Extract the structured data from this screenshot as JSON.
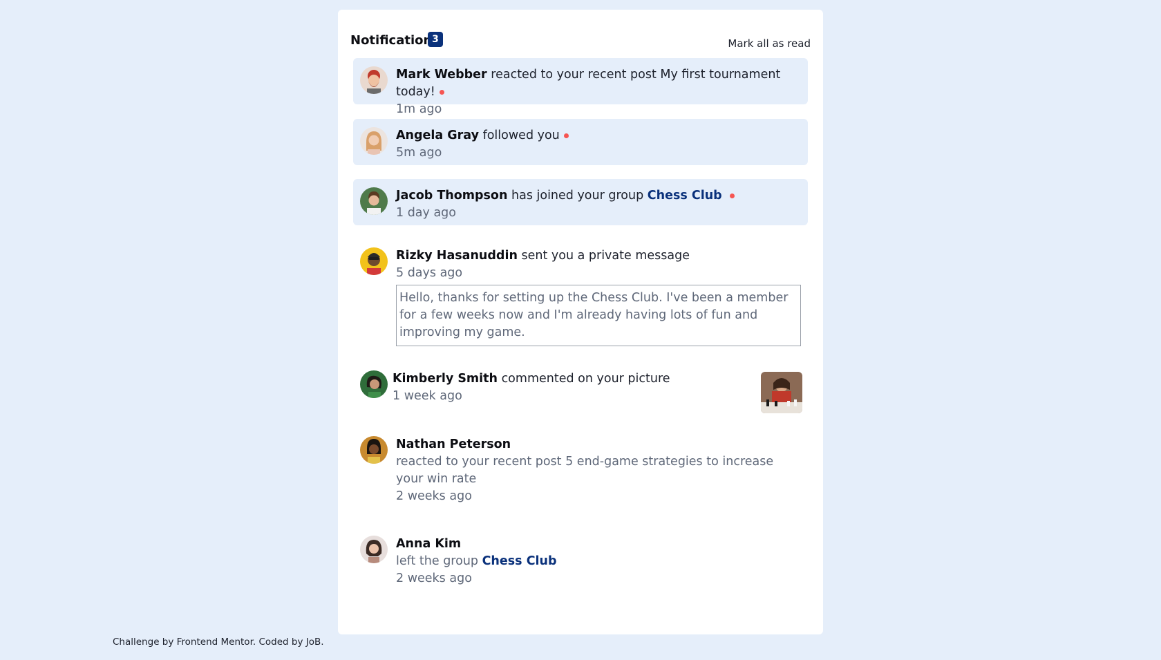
{
  "header": {
    "title": "Notifications",
    "badge": "3",
    "mark_all": "Mark all as read"
  },
  "notifications": [
    {
      "name": "Mark Webber",
      "action": "reacted to your recent post",
      "target": "My first tournament today!",
      "time": "1m ago",
      "unread": true,
      "avatar_icon": "avatar-mark-webber"
    },
    {
      "name": "Angela Gray",
      "action": "followed you",
      "time": "5m ago",
      "unread": true,
      "avatar_icon": "avatar-angela-gray"
    },
    {
      "name": "Jacob Thompson",
      "action": "has joined your group",
      "group": "Chess Club",
      "time": "1 day ago",
      "unread": true,
      "avatar_icon": "avatar-jacob-thompson"
    },
    {
      "name": "Rizky Hasanuddin",
      "action": "sent you a private message",
      "time": "5 days ago",
      "message": "Hello, thanks for setting up the Chess Club. I've been a member for a few weeks now and I'm already having lots of fun and improving my game.",
      "unread": false,
      "avatar_icon": "avatar-rizky-hasanuddin"
    },
    {
      "name": "Kimberly Smith",
      "action": "commented on your picture",
      "time": "1 week ago",
      "unread": false,
      "avatar_icon": "avatar-kimberly-smith",
      "picture_icon": "chess-picture-thumbnail"
    },
    {
      "name": "Nathan Peterson",
      "action": "reacted to your recent post 5 end-game strategies to increase your win rate",
      "time": "2 weeks ago",
      "unread": false,
      "avatar_icon": "avatar-nathan-peterson"
    },
    {
      "name": "Anna Kim",
      "action": "left the group",
      "group": "Chess Club",
      "time": "2 weeks ago",
      "unread": false,
      "avatar_icon": "avatar-anna-kim"
    }
  ],
  "footer": {
    "text": "Challenge by Frontend Mentor. Coded by JoB."
  },
  "colors": {
    "page_background": "#e5eefa",
    "card": "#ffffff",
    "badge": "#0a317b",
    "unread_dot": "#f65552",
    "group_link": "#0a317b",
    "secondary_text": "#5e6778"
  }
}
